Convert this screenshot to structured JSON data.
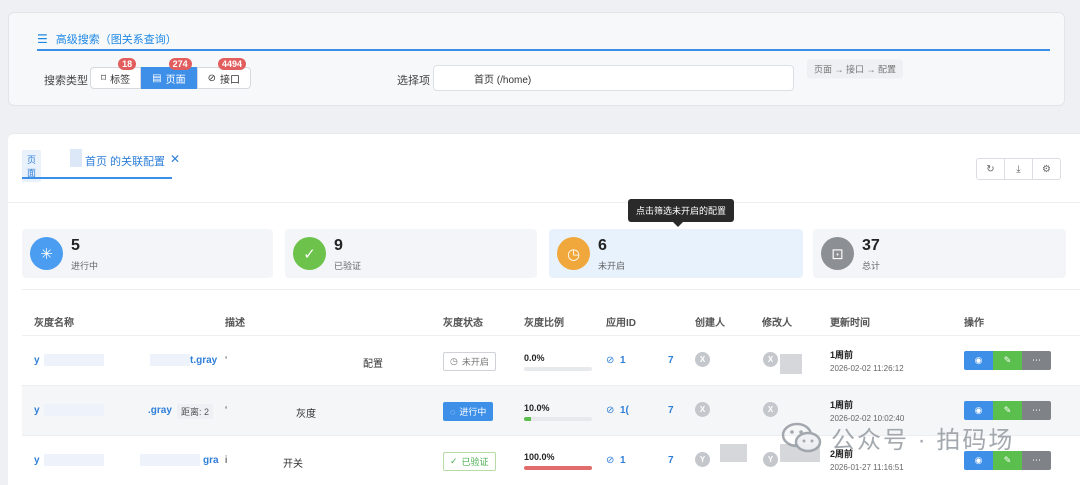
{
  "search": {
    "title": "高级搜索（图关系查询）",
    "type_label": "搜索类型",
    "types": [
      {
        "label": "标签",
        "count": "18",
        "icon": "bookmark-icon"
      },
      {
        "label": "页面",
        "count": "274",
        "icon": "page-icon"
      },
      {
        "label": "接口",
        "count": "4494",
        "icon": "link-icon"
      }
    ],
    "select_label": "选择项",
    "select_value": "首页 (/home)",
    "path_hint": "页面 → 接口 → 配置"
  },
  "tab": {
    "badge": "页面",
    "title": "首页 的关联配置",
    "close": "✕"
  },
  "tooltip": "点击筛选未开启的配置",
  "stats": [
    {
      "num": "5",
      "label": "进行中",
      "color": "#4a9df0",
      "icon": "loading-icon"
    },
    {
      "num": "9",
      "label": "已验证",
      "color": "#6cc24a",
      "icon": "check-icon"
    },
    {
      "num": "6",
      "label": "未开启",
      "color": "#f0a83c",
      "icon": "clock-icon"
    },
    {
      "num": "37",
      "label": "总计",
      "color": "#8c8f94",
      "icon": "total-icon"
    }
  ],
  "table": {
    "headers": [
      "灰度名称",
      "描述",
      "灰度状态",
      "灰度比例",
      "应用ID",
      "创建人",
      "修改人",
      "更新时间",
      "操作"
    ],
    "rows": [
      {
        "name_start": "y",
        "name_end": "t.gray",
        "desc_mark": "‘",
        "desc": "配置",
        "status": "未开启",
        "pct": "0.0%",
        "pct_value": 0,
        "app_id": "1",
        "app_id_2": "7",
        "creator": "X",
        "modifier": "X",
        "time_rel": "1周前",
        "time_abs": "2026-02-02 11:26:12"
      },
      {
        "name_start": "y",
        "name_end": ".gray",
        "dist": "距离: 2",
        "desc_mark": "‘",
        "desc": "灰度",
        "status": "进行中",
        "pct": "10.0%",
        "pct_value": 10,
        "app_id": "1(",
        "app_id_2": "7",
        "creator": "X",
        "modifier": "X",
        "time_rel": "1周前",
        "time_abs": "2026-02-02 10:02:40"
      },
      {
        "name_start": "y",
        "name_end": "gra",
        "desc_mark": "i",
        "desc": "开关",
        "status": "已验证",
        "pct": "100.0%",
        "pct_value": 100,
        "app_id": "1",
        "app_id_2": "7",
        "creator": "Y",
        "modifier": "Y",
        "time_rel": "2周前",
        "time_abs": "2026-01-27 11:16:51"
      }
    ]
  },
  "watermark": "公众号 · 拍码场",
  "colors": {
    "accent": "#3d8fe8",
    "badge": "#e25d5d",
    "ok": "#5bbf4d"
  }
}
